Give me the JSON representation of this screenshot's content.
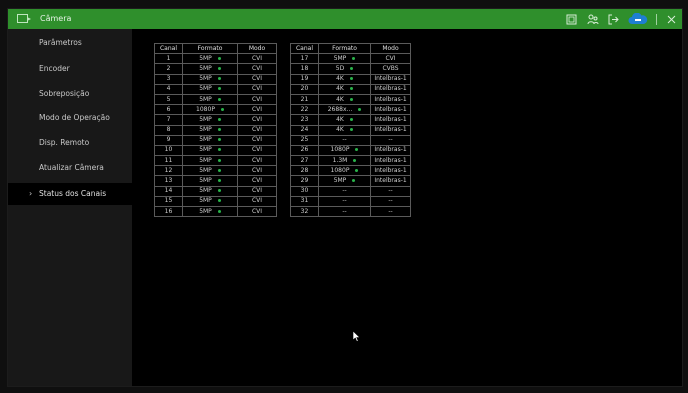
{
  "window": {
    "title": "Câmera",
    "accent_color": "#2f8f2c",
    "icons": [
      "screen-icon",
      "users-icon",
      "logout-icon",
      "cloud-icon",
      "close-icon"
    ]
  },
  "sidebar": {
    "items": [
      {
        "label": "Parâmetros",
        "active": false
      },
      {
        "label": "Encoder",
        "active": false
      },
      {
        "label": "Sobreposição",
        "active": false
      },
      {
        "label": "Modo de Operação",
        "active": false
      },
      {
        "label": "Disp. Remoto",
        "active": false
      },
      {
        "label": "Atualizar Câmera",
        "active": false
      },
      {
        "label": "Status dos Canais",
        "active": true
      }
    ]
  },
  "status_table": {
    "headers": [
      "Canal",
      "Formato",
      "Modo"
    ],
    "left": [
      {
        "canal": "1",
        "formato": "5MP",
        "dot": true,
        "modo": "CVI"
      },
      {
        "canal": "2",
        "formato": "5MP",
        "dot": true,
        "modo": "CVI"
      },
      {
        "canal": "3",
        "formato": "5MP",
        "dot": true,
        "modo": "CVI"
      },
      {
        "canal": "4",
        "formato": "5MP",
        "dot": true,
        "modo": "CVI"
      },
      {
        "canal": "5",
        "formato": "5MP",
        "dot": true,
        "modo": "CVI"
      },
      {
        "canal": "6",
        "formato": "1080P",
        "dot": true,
        "modo": "CVI"
      },
      {
        "canal": "7",
        "formato": "5MP",
        "dot": true,
        "modo": "CVI"
      },
      {
        "canal": "8",
        "formato": "5MP",
        "dot": true,
        "modo": "CVI"
      },
      {
        "canal": "9",
        "formato": "5MP",
        "dot": true,
        "modo": "CVI"
      },
      {
        "canal": "10",
        "formato": "5MP",
        "dot": true,
        "modo": "CVI"
      },
      {
        "canal": "11",
        "formato": "5MP",
        "dot": true,
        "modo": "CVI"
      },
      {
        "canal": "12",
        "formato": "5MP",
        "dot": true,
        "modo": "CVI"
      },
      {
        "canal": "13",
        "formato": "5MP",
        "dot": true,
        "modo": "CVI"
      },
      {
        "canal": "14",
        "formato": "5MP",
        "dot": true,
        "modo": "CVI"
      },
      {
        "canal": "15",
        "formato": "5MP",
        "dot": true,
        "modo": "CVI"
      },
      {
        "canal": "16",
        "formato": "5MP",
        "dot": true,
        "modo": "CVI"
      }
    ],
    "right": [
      {
        "canal": "17",
        "formato": "5MP",
        "dot": true,
        "modo": "CVI"
      },
      {
        "canal": "18",
        "formato": "5D",
        "dot": true,
        "modo": "CVBS"
      },
      {
        "canal": "19",
        "formato": "4K",
        "dot": true,
        "modo": "Intelbras-1"
      },
      {
        "canal": "20",
        "formato": "4K",
        "dot": true,
        "modo": "Intelbras-1"
      },
      {
        "canal": "21",
        "formato": "4K",
        "dot": true,
        "modo": "Intelbras-1"
      },
      {
        "canal": "22",
        "formato": "2688x...",
        "dot": true,
        "modo": "Intelbras-1"
      },
      {
        "canal": "23",
        "formato": "4K",
        "dot": true,
        "modo": "Intelbras-1"
      },
      {
        "canal": "24",
        "formato": "4K",
        "dot": true,
        "modo": "Intelbras-1"
      },
      {
        "canal": "25",
        "formato": "--",
        "dot": false,
        "modo": "--"
      },
      {
        "canal": "26",
        "formato": "1080P",
        "dot": true,
        "modo": "Intelbras-1"
      },
      {
        "canal": "27",
        "formato": "1.3M",
        "dot": true,
        "modo": "Intelbras-1"
      },
      {
        "canal": "28",
        "formato": "1080P",
        "dot": true,
        "modo": "Intelbras-1"
      },
      {
        "canal": "29",
        "formato": "5MP",
        "dot": true,
        "modo": "Intelbras-1"
      },
      {
        "canal": "30",
        "formato": "--",
        "dot": false,
        "modo": "--"
      },
      {
        "canal": "31",
        "formato": "--",
        "dot": false,
        "modo": "--"
      },
      {
        "canal": "32",
        "formato": "--",
        "dot": false,
        "modo": "--"
      }
    ],
    "status_dot_color": "#29b34a"
  }
}
